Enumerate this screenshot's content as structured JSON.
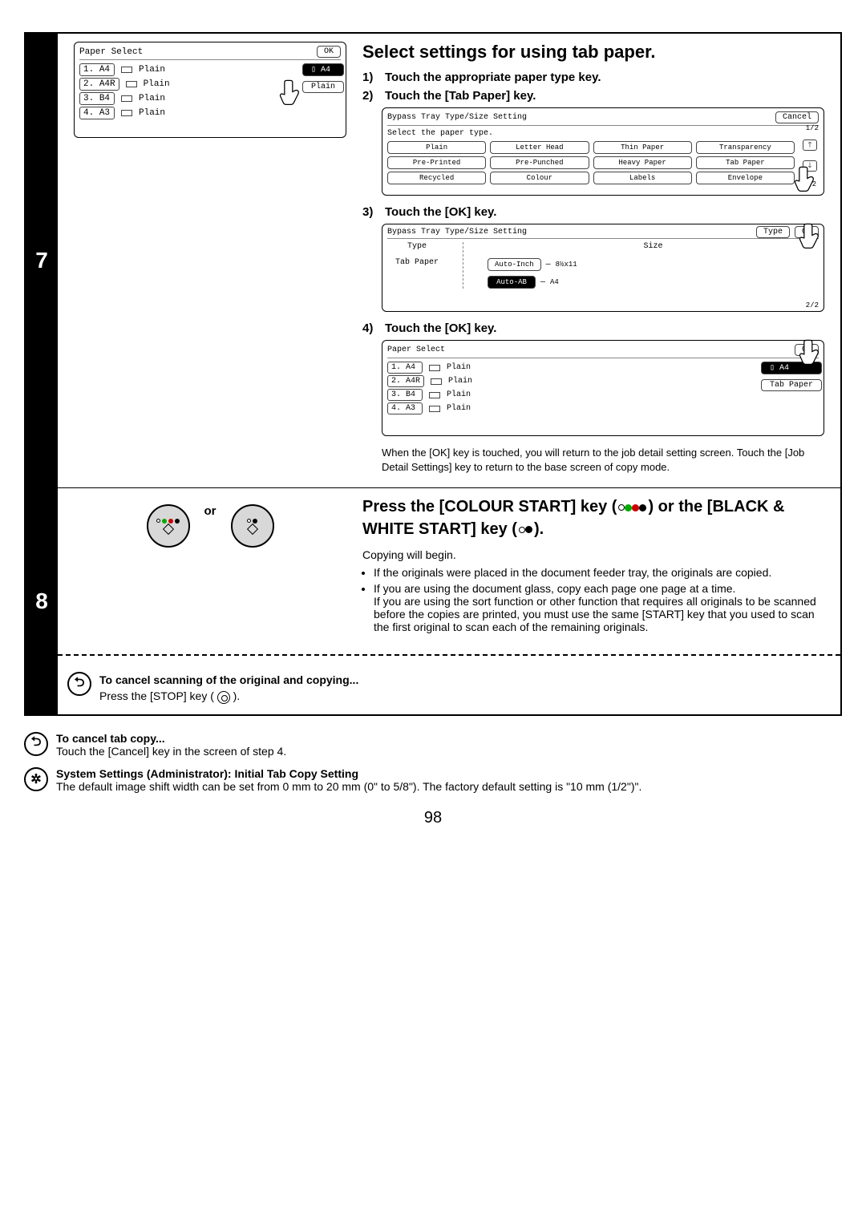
{
  "page_number": "98",
  "step7": {
    "number": "7",
    "title": "Select settings for using tab paper.",
    "sub1_num": "1)",
    "sub1_text": "Touch the appropriate paper type key.",
    "sub2_num": "2)",
    "sub2_text": "Touch the [Tab Paper] key.",
    "sub3_num": "3)",
    "sub3_text": "Touch the [OK] key.",
    "sub4_num": "4)",
    "sub4_text": "Touch the  [OK] key.",
    "note_after": "When the [OK] key is touched, you will return to the job detail setting screen. Touch the [Job Detail Settings] key to return to the base screen of copy mode.",
    "panel_left": {
      "title": "Paper Select",
      "ok": "OK",
      "rows": [
        {
          "no": "1.",
          "size": "A4",
          "type": "Plain"
        },
        {
          "no": "2.",
          "size": "A4R",
          "type": "Plain"
        },
        {
          "no": "3.",
          "size": "B4",
          "type": "Plain"
        },
        {
          "no": "4.",
          "size": "A3",
          "type": "Plain"
        }
      ],
      "side_sel": "A4",
      "side_type": "Plain"
    },
    "panel_bypass": {
      "title": "Bypass Tray Type/Size Setting",
      "cancel": "Cancel",
      "prompt": "Select the paper type.",
      "page": "1/2",
      "page2": "1/2",
      "types": [
        "Plain",
        "Letter Head",
        "Thin Paper",
        "Transparency",
        "Pre-Printed",
        "Pre-Punched",
        "Heavy Paper",
        "Tab Paper",
        "Recycled",
        "Colour",
        "Labels",
        "Envelope"
      ]
    },
    "panel_type_size": {
      "title": "Bypass Tray Type/Size Setting",
      "type_btn": "Type",
      "ok": "OK",
      "type_head": "Type",
      "size_head": "Size",
      "tab_paper": "Tab Paper",
      "auto_inch": "Auto-Inch",
      "auto_ab": "Auto-AB",
      "size_inch": "8½x11",
      "size_ab": "A4",
      "page": "2/2"
    },
    "panel_final": {
      "title": "Paper Select",
      "ok": "OK",
      "rows": [
        {
          "no": "1.",
          "size": "A4",
          "type": "Plain"
        },
        {
          "no": "2.",
          "size": "A4R",
          "type": "Plain"
        },
        {
          "no": "3.",
          "size": "B4",
          "type": "Plain"
        },
        {
          "no": "4.",
          "size": "A3",
          "type": "Plain"
        }
      ],
      "side_sel": "A4",
      "side_type": "Tab Paper"
    }
  },
  "step8": {
    "number": "8",
    "or": "or",
    "title_1": "Press the [COLOUR START] key (",
    "title_2": ") or the [BLACK & WHITE START] key (",
    "title_3": ").",
    "begin": "Copying will begin.",
    "b1": "If the originals were placed in the document feeder tray, the originals are copied.",
    "b2": "If you are using the document glass, copy each page one page at a time.",
    "b2_cont": "If you are using the sort function or other function that requires all originals to be scanned before the copies are printed, you must use the same [START] key that you used to scan the first original to scan each of the remaining originals.",
    "cancel_scan_hd": "To cancel scanning of the original and copying...",
    "cancel_scan_body": "Press the [STOP] key ( "
  },
  "footer": {
    "cancel_hd": "To cancel tab copy...",
    "cancel_body": "Touch the [Cancel] key in the screen of step 4.",
    "sys_hd": "System Settings (Administrator): Initial Tab Copy Setting",
    "sys_body": "The default image shift width can be set from 0 mm to 20 mm (0\" to 5/8\"). The factory default setting is \"10 mm (1/2\")\"."
  }
}
